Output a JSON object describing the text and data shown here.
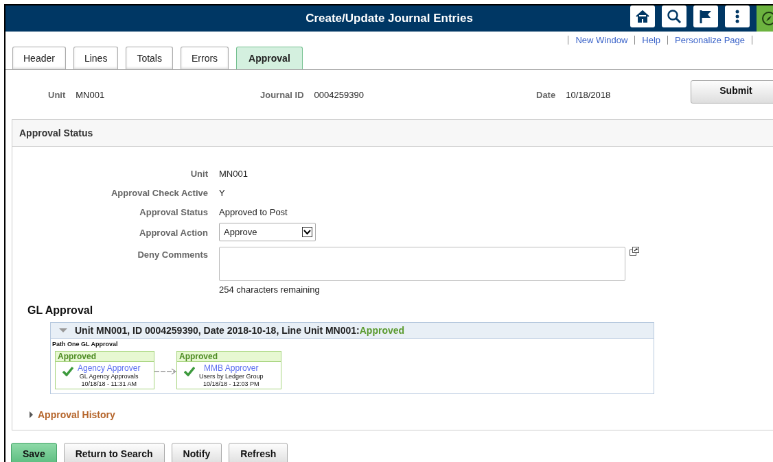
{
  "header": {
    "title": "Create/Update Journal Entries"
  },
  "links": [
    "New Window",
    "Help",
    "Personalize Page"
  ],
  "tabs": [
    {
      "label": "Header",
      "selected": false
    },
    {
      "label": "Lines",
      "selected": false
    },
    {
      "label": "Totals",
      "selected": false
    },
    {
      "label": "Errors",
      "selected": false
    },
    {
      "label": "Approval",
      "selected": true
    }
  ],
  "summary": [
    {
      "label": "Unit",
      "value": "MN001"
    },
    {
      "label": "Journal ID",
      "value": "0004259390"
    },
    {
      "label": "Date",
      "value": "10/18/2018"
    }
  ],
  "submit_button": "Submit",
  "approval_status": {
    "title": "Approval Status",
    "fields": [
      {
        "kind": "text",
        "label": "Unit",
        "value": "MN001"
      },
      {
        "kind": "text",
        "label": "Approval Check Active",
        "value": "Y"
      },
      {
        "kind": "text",
        "label": "Approval Status",
        "value": "Approved to Post"
      },
      {
        "kind": "select",
        "label": "Approval Action",
        "value": "Approve"
      },
      {
        "kind": "textarea",
        "label": "Deny Comments",
        "hint": "254 characters remaining"
      }
    ],
    "gl_approval": {
      "title": "GL Approval",
      "expanded": true,
      "heading": "Unit MN001, ID 0004259390, Date 2018-10-18, Line Unit MN001:",
      "status": "Approved",
      "path_title": "Path One GL Approval",
      "steps": [
        {
          "status": "Approved",
          "approver": "Agency Approver",
          "group": "GL Agency Approvals",
          "time": "10/18/18 - 11:31 AM"
        },
        {
          "status": "Approved",
          "approver": "MMB Approver",
          "group": "Users by Ledger Group",
          "time": "10/18/18 - 12:03 PM"
        }
      ]
    },
    "history": {
      "label": "Approval History",
      "expanded": false
    }
  },
  "buttons": [
    {
      "label": "Save",
      "kind": "primary"
    },
    {
      "label": "Return to Search",
      "kind": "normal"
    },
    {
      "label": "Notify",
      "kind": "normal"
    },
    {
      "label": "Refresh",
      "kind": "normal"
    }
  ]
}
